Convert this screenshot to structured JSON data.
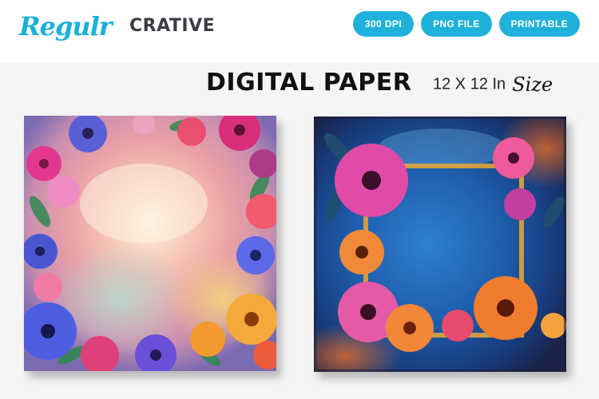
{
  "brand": {
    "script_part": "Regulr",
    "block_part": "CRATIVE",
    "color": "#1ab0d8"
  },
  "badges": [
    {
      "label": "300 DPI"
    },
    {
      "label": "PNG FILE"
    },
    {
      "label": "PRINTABLE"
    }
  ],
  "badge_color": "#1fb1d9",
  "title": "DIGITAL PAPER",
  "size": {
    "dimension": "12 X 12 In",
    "word": "Size"
  },
  "papers": [
    {
      "icon": "floral-watercolor-pastel-paper"
    },
    {
      "icon": "floral-blue-grunge-frame-paper"
    }
  ]
}
